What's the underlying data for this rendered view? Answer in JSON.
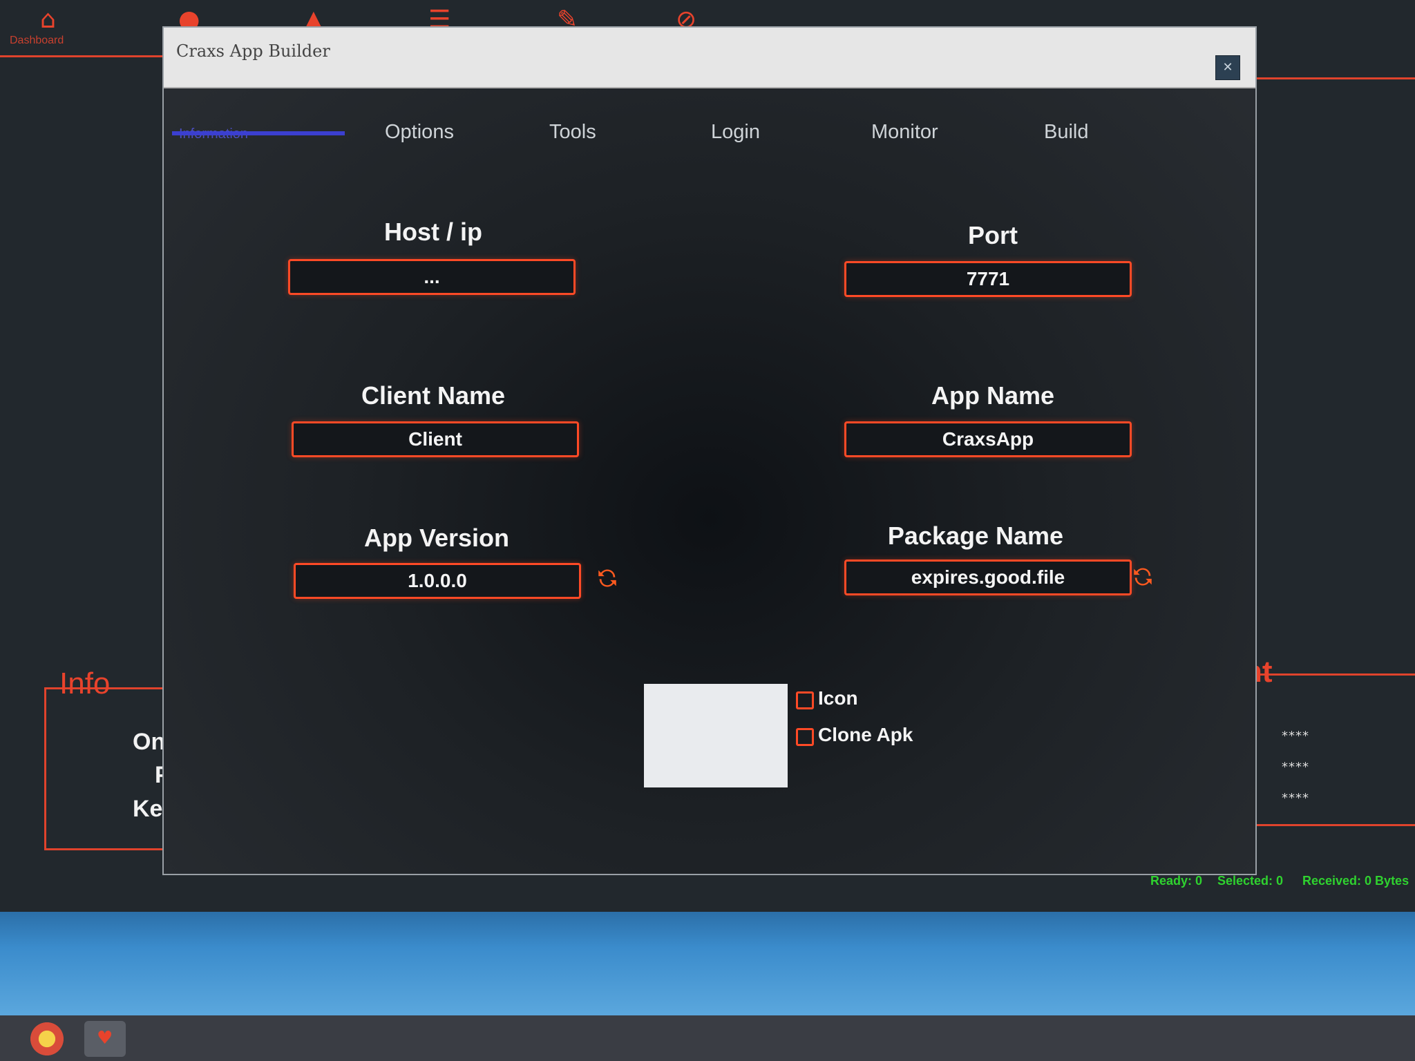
{
  "window": {
    "title": "Craxs App Builder",
    "close_label": "✕"
  },
  "tabs": [
    {
      "label": "Information"
    },
    {
      "label": "Options"
    },
    {
      "label": "Tools"
    },
    {
      "label": "Login"
    },
    {
      "label": "Monitor"
    },
    {
      "label": "Build"
    }
  ],
  "form": {
    "host": {
      "label": "Host / ip",
      "value": "..."
    },
    "port": {
      "label": "Port",
      "value": "7771"
    },
    "client_name": {
      "label": "Client Name",
      "value": "Client"
    },
    "app_name": {
      "label": "App Name",
      "value": "CraxsApp"
    },
    "app_version": {
      "label": "App Version",
      "value": "1.0.0.0"
    },
    "package_name": {
      "label": "Package Name",
      "value": "expires.good.file"
    }
  },
  "options": {
    "icon": {
      "label": "Icon",
      "checked": false
    },
    "clone_apk": {
      "label": "Clone Apk",
      "checked": false
    }
  },
  "background": {
    "dashboard_label": "Dashboard",
    "info_title": "Info",
    "info_labels": [
      "Onli",
      "Po",
      "Key"
    ],
    "right_title": "nt",
    "right_values": [
      "****",
      "****",
      "****"
    ],
    "status": {
      "ready": "Ready: 0",
      "selected": "Selected: 0",
      "received": "Received: 0 Bytes"
    }
  },
  "colors": {
    "accent": "#ff4a26",
    "tab_active": "#3b3fd0",
    "status_green": "#2fd22f"
  },
  "icons": {
    "refresh": "refresh-icon",
    "close": "close-icon"
  }
}
